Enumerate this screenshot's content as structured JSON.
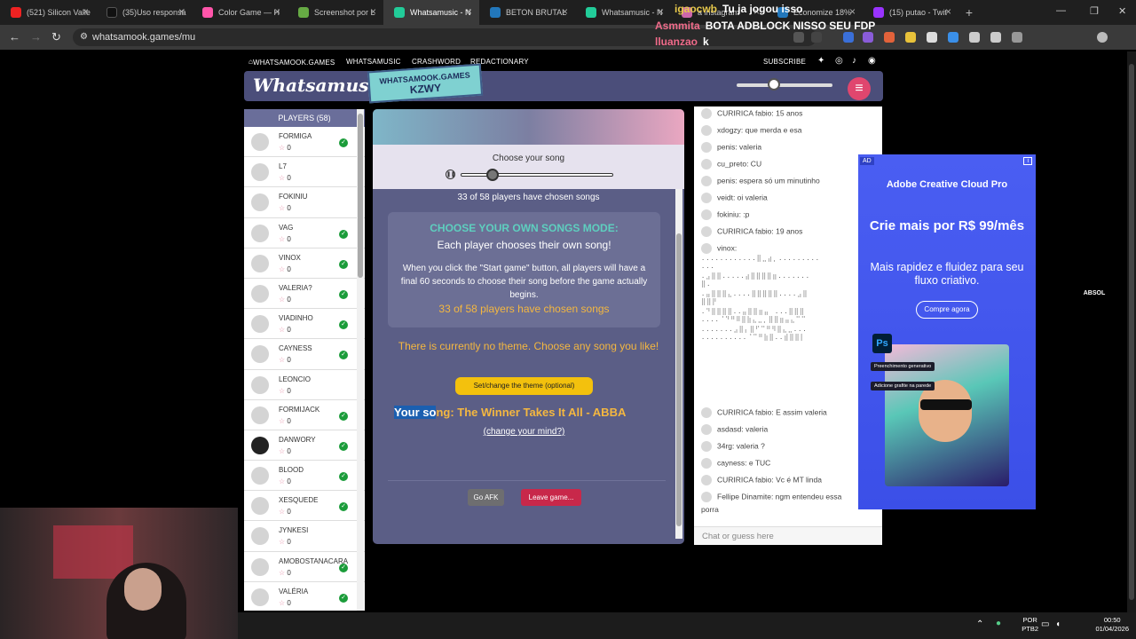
{
  "browser": {
    "tabs": [
      {
        "label": "(521) Silicon Valle",
        "color": "#e22"
      },
      {
        "label": "(35)Uso responsá",
        "color": "#111"
      },
      {
        "label": "Color Game — H",
        "color": "#f5a"
      },
      {
        "label": "Screenshot por L",
        "color": "#6a4"
      },
      {
        "label": "Whatsamusic - N",
        "color": "#2c9",
        "active": true
      },
      {
        "label": "BETON BRUTAL",
        "color": "#27b"
      },
      {
        "label": "Whatsamusic - N",
        "color": "#2c9"
      },
      {
        "label": "a instagram",
        "color": "#c6a"
      },
      {
        "label": "Economize 18%",
        "color": "#27b"
      },
      {
        "label": "(15) putao - Twit",
        "color": "#93f"
      }
    ],
    "url": "whatsamook.games/mu",
    "new_tab": "+",
    "close": "×"
  },
  "overlay_chat": [
    {
      "name": "igaocwb",
      "text": "Tu ja jogou isso",
      "color": "#e6c84b"
    },
    {
      "name": "Asmmita",
      "text": "BOTA ADBLOCK NISSO SEU FDP",
      "color": "#f06b8a"
    },
    {
      "name": "lluanzao",
      "text": "k",
      "color": "#f06b8a"
    }
  ],
  "site_nav": {
    "home": "WHATSAMOOK.GAMES",
    "whatsamusic": "WHATSAMUSIC",
    "crashword": "CRASHWORD",
    "redactionary": "REDACTIONARY",
    "subscribe": "SUBSCRIBE"
  },
  "header": {
    "logo": "Whatsamusic",
    "badge_site": "WHATSAMOOK.GAMES",
    "badge_code": "KZWY"
  },
  "players": {
    "header": "PLAYERS (58)",
    "list": [
      {
        "name": "FORMIGA",
        "score": "0",
        "chosen": true
      },
      {
        "name": "L7",
        "score": "0",
        "chosen": false
      },
      {
        "name": "FOKINIU",
        "score": "0",
        "chosen": false
      },
      {
        "name": "VAG",
        "score": "0",
        "chosen": true
      },
      {
        "name": "VINOX",
        "score": "0",
        "chosen": true
      },
      {
        "name": "VALERIA?",
        "score": "0",
        "chosen": true
      },
      {
        "name": "VIADINHO",
        "score": "0",
        "chosen": true
      },
      {
        "name": "CAYNESS",
        "score": "0",
        "chosen": true
      },
      {
        "name": "LEONCIO",
        "score": "0",
        "chosen": false
      },
      {
        "name": "FORMIJACK",
        "score": "0",
        "chosen": true
      },
      {
        "name": "DANWORY",
        "score": "0",
        "chosen": true,
        "dark": true
      },
      {
        "name": "BLOOD",
        "score": "0",
        "chosen": true
      },
      {
        "name": "XESQUEDE",
        "score": "0",
        "chosen": true
      },
      {
        "name": "JYNKESI",
        "score": "0",
        "chosen": false
      },
      {
        "name": "AMOBOSTANACARA",
        "score": "0",
        "chosen": true
      },
      {
        "name": "VALÉRIA",
        "score": "0",
        "chosen": true
      }
    ]
  },
  "game": {
    "choose_label": "Choose your song",
    "chosen_top": "33 of 58 players have chosen songs",
    "mode_title": "CHOOSE YOUR OWN SONGS MODE:",
    "mode_sub": "Each player chooses their own song!",
    "mode_desc": "When you click the \"Start game\" button, all players will have a final 60 seconds to choose their song before the game actually begins.",
    "mode_count": "33 of 58 players have chosen songs",
    "theme_text": "There is currently no theme. Choose any song you like!",
    "theme_button": "Set/change the theme (optional)",
    "your_song_hl": "Your so",
    "your_song_rest": "ng: The Winner Takes It All - ABBA",
    "change_mind": "(change your mind?)",
    "afk": "Go AFK",
    "leave": "Leave game..."
  },
  "chat": {
    "messages": [
      {
        "text": "CURIRICA fabio: 15 anos"
      },
      {
        "text": "xdogzy: que merda e esa"
      },
      {
        "text": "penis: valeria"
      },
      {
        "text": "cu_preto: CU"
      },
      {
        "text": "penis: espera só um minutinho"
      },
      {
        "text": "veidt: oi valeria"
      },
      {
        "text": "fokiniu: :p"
      },
      {
        "text": "CURIRICA fabio: 19 anos"
      },
      {
        "text": "vinox:"
      }
    ],
    "ascii": [
      "............⣿⣀⣴⡀.........",
      "...",
      ".⣠⣿⣿.....⣴⣿⣿⣿⣿⣶.......",
      "⣿.",
      ".⣤⣿⣿⣿⣄....⣿⣿⣿⣿⣿....⣠⣿",
      "⣿⣿⡟",
      ".⠙⣿⣿⣿⣿..⣤⣿⣿⣶⣤⠀...⣿⣿⣿",
      "....⠈⠙⠛⠿⣿⣷⣄⣀⡀⣿⣿⣶⣤⣄⠉⠉",
      ".......⣠⣿⡄⣿⠋⠉⠛⠻⣿⣄⣀...",
      "..........⠈⠉⠛⣷⣿..⣾⣿⣿⡇"
    ],
    "messages2": [
      {
        "text": "CURIRICA fabio: E assim valeria"
      },
      {
        "text": "asdasd: valeria"
      },
      {
        "text": "34rg: valeria ?"
      },
      {
        "text": "cayness: e TUC"
      },
      {
        "text": "CURIRICA fabio: Vc é MT linda"
      },
      {
        "text": "Fellipe Dinamite: ngm entendeu essa"
      },
      {
        "text": "porra"
      }
    ],
    "placeholder": "Chat or guess here"
  },
  "ad": {
    "tag": "AD",
    "title": "Adobe Creative Cloud Pro",
    "price": "Crie mais por R$ 99/mês",
    "text": "Mais rapidez e fluidez para seu fluxo criativo.",
    "button": "Compre agora",
    "ps": "Ps",
    "lbl1": "Preenchimento generativo",
    "lbl2": "Adicione grafite na parede"
  },
  "side_label": "ABSOL",
  "taskbar": {
    "lang1": "POR",
    "lang2": "PTB2",
    "time": "00:50",
    "date": "01/04/2026"
  }
}
